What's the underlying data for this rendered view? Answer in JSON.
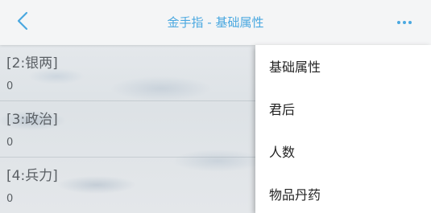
{
  "header": {
    "title": "金手指 - 基础属性",
    "back_icon": "chevron-left-icon",
    "more_icon": "more-horizontal-icon",
    "accent_color": "#4aa8e0"
  },
  "list": {
    "items": [
      {
        "label": "[2:银两]",
        "value": "0"
      },
      {
        "label": "[3:政治]",
        "value": "0"
      },
      {
        "label": "[4:兵力]",
        "value": "0"
      }
    ]
  },
  "menu": {
    "items": [
      {
        "label": "基础属性"
      },
      {
        "label": "君后"
      },
      {
        "label": "人数"
      },
      {
        "label": "物品丹药"
      }
    ]
  }
}
